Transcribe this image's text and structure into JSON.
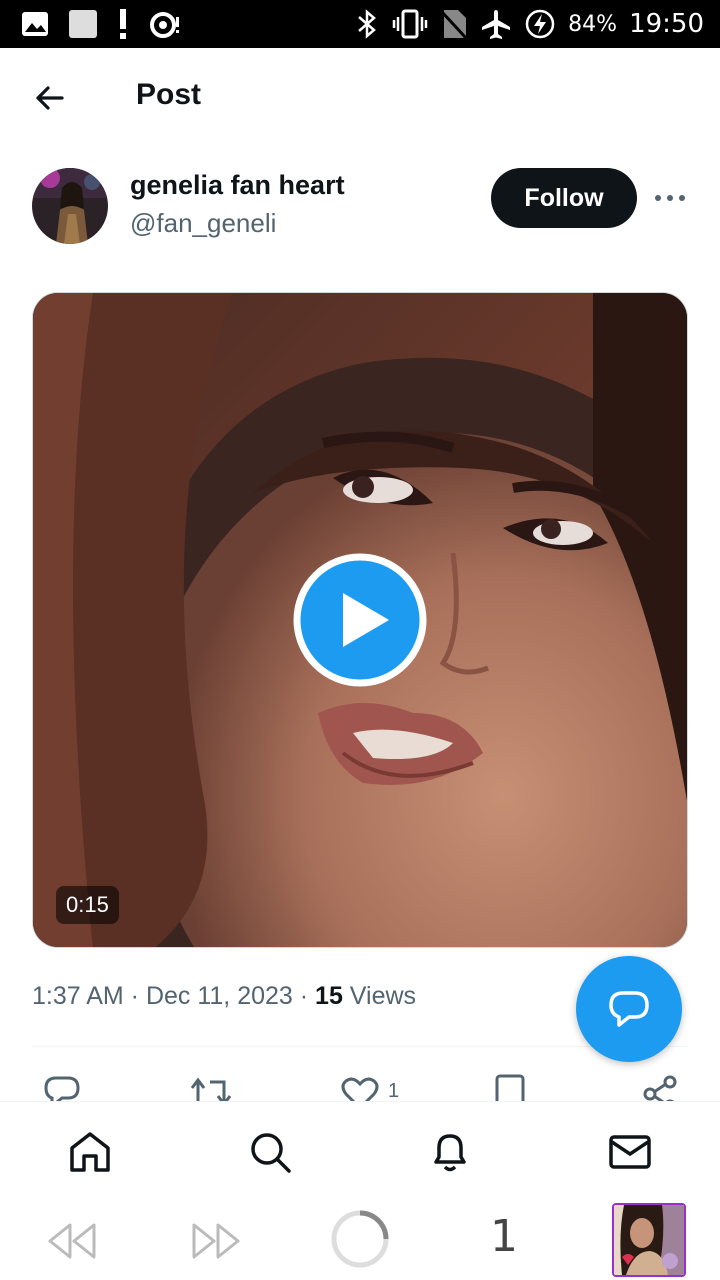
{
  "status_bar": {
    "battery": "84%",
    "time": "19:50",
    "icons": [
      "image-icon",
      "square-icon",
      "alert-icon",
      "sync-icon",
      "bluetooth-icon",
      "vibrate-icon",
      "no-sim-icon",
      "airplane-icon",
      "battery-charging-icon"
    ]
  },
  "header": {
    "title": "Post"
  },
  "author": {
    "name": "genelia fan heart",
    "handle": "@fan_geneli",
    "follow_label": "Follow"
  },
  "media": {
    "duration": "0:15"
  },
  "meta": {
    "time": "1:37 AM",
    "sep1": " · ",
    "date": "Dec 11, 2023",
    "sep2": " · ",
    "views_count": "15",
    "views_label": " Views"
  },
  "actions": {
    "like_count": "1"
  },
  "bottom_nav": [
    "home-icon",
    "search-icon",
    "notifications-icon",
    "messages-icon"
  ],
  "system_bar": {
    "tab_count": "1"
  },
  "colors": {
    "accent": "#1d9bf0",
    "text": "#0f1419",
    "muted": "#536471"
  }
}
